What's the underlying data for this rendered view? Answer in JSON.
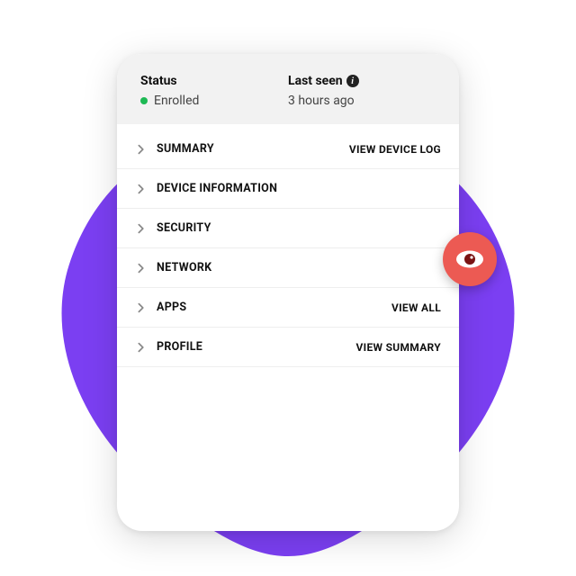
{
  "colors": {
    "bg_shape": "#7b3ff2",
    "status_dot": "#1db954",
    "eye_badge": "#ec5a53",
    "eye_pupil": "#7a1414"
  },
  "header": {
    "status_label": "Status",
    "status_value": "Enrolled",
    "lastseen_label": "Last seen",
    "lastseen_value": "3 hours ago"
  },
  "rows": [
    {
      "label": "SUMMARY",
      "action": "VIEW DEVICE LOG"
    },
    {
      "label": "DEVICE INFORMATION",
      "action": ""
    },
    {
      "label": "SECURITY",
      "action": ""
    },
    {
      "label": "NETWORK",
      "action": ""
    },
    {
      "label": "APPS",
      "action": "VIEW ALL"
    },
    {
      "label": "PROFILE",
      "action": "VIEW SUMMARY"
    }
  ],
  "icons": {
    "info_glyph": "i"
  }
}
